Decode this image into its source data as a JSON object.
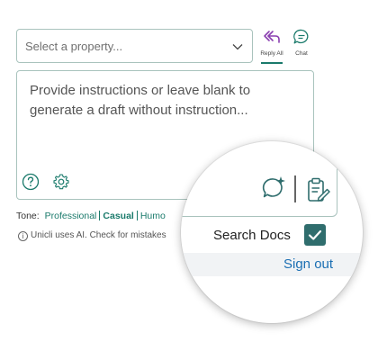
{
  "property_select": {
    "placeholder": "Select a property..."
  },
  "modes": {
    "reply_all_label": "Reply All",
    "chat_label": "Chat",
    "active_color": "#1a7a6b",
    "reply_icon_color": "#8a3fb0"
  },
  "instructions": {
    "placeholder": "Provide instructions or leave blank to generate a draft without instruction..."
  },
  "tone": {
    "label": "Tone:",
    "options": [
      "Professional",
      "Casual",
      "Humo"
    ],
    "selected": "Casual"
  },
  "disclaimer": "Unicli uses AI. Check for mistakes",
  "magnifier": {
    "search_docs_label": "Search Docs",
    "search_docs_checked": true,
    "sign_out_label": "Sign out",
    "check_color": "#2f6d6d",
    "link_color": "#1b6fb3"
  }
}
